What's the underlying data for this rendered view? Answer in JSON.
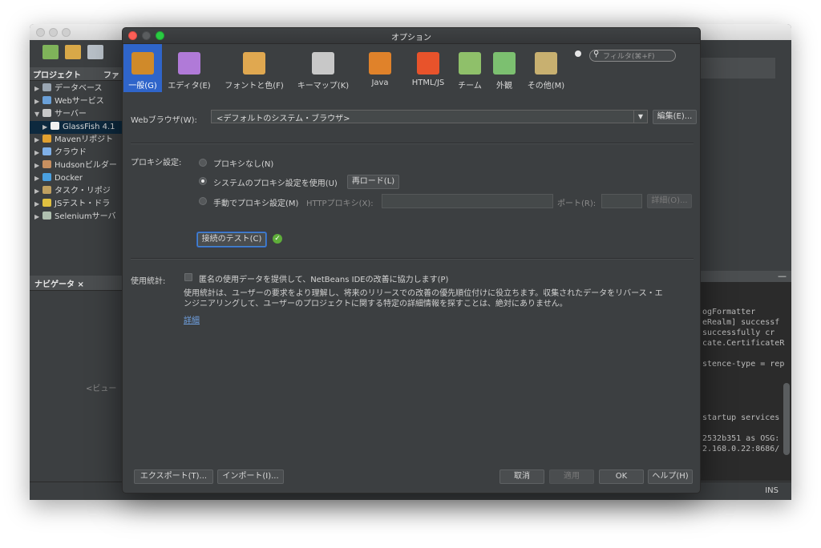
{
  "ide": {
    "project_tab": "プロジェクト",
    "files_tab": "ファ",
    "tree": [
      {
        "label": "データベース",
        "color": "#9aa6b2"
      },
      {
        "label": "Webサービス",
        "color": "#6aa0d8"
      },
      {
        "label": "サーバー",
        "color": "#c8c8c8"
      },
      {
        "label": "GlassFish 4.1",
        "color": "#f0f0f0",
        "selected": true
      },
      {
        "label": "Mavenリポジト",
        "color": "#e0a030"
      },
      {
        "label": "クラウド",
        "color": "#7fb0e8"
      },
      {
        "label": "Hudsonビルダー",
        "color": "#c89060"
      },
      {
        "label": "Docker",
        "color": "#4aa0e0"
      },
      {
        "label": "タスク・リポジ",
        "color": "#c0a060"
      },
      {
        "label": "JSテスト・ドラ",
        "color": "#e0c040"
      },
      {
        "label": "Seleniumサーバ",
        "color": "#b0c0b0"
      }
    ],
    "navigator_tab": "ナビゲータ ×",
    "navigator_empty": "<ビュー",
    "output_lines": [
      "ogFormatter",
      "eRealm] successf",
      " successfully cr",
      "cate.CertificateR",
      "stence-type = rep",
      " startup services",
      "2532b351 as OSG:",
      "2.168.0.22:8686/"
    ],
    "status_ins": "INS"
  },
  "dialog": {
    "title": "オプション",
    "categories": [
      {
        "label": "一般(G)",
        "icon": "general-icon",
        "color": "#d08a2a"
      },
      {
        "label": "エディタ(E)",
        "icon": "editor-icon",
        "color": "#b07ad8"
      },
      {
        "label": "フォントと色(F)",
        "icon": "fonts-icon",
        "color": "#e0a850"
      },
      {
        "label": "キーマップ(K)",
        "icon": "keymap-icon",
        "color": "#c8c8c8"
      },
      {
        "label": "Java",
        "icon": "java-icon",
        "color": "#e0822a"
      },
      {
        "label": "HTML/JS",
        "icon": "html5-icon",
        "color": "#e8532b"
      },
      {
        "label": "チーム",
        "icon": "team-icon",
        "color": "#8fc06a"
      },
      {
        "label": "外観",
        "icon": "appearance-icon",
        "color": "#7cc070"
      },
      {
        "label": "その他(M)",
        "icon": "misc-icon",
        "color": "#c8b070"
      }
    ],
    "search_placeholder": "フィルタ(⌘+F)",
    "web_browser_label": "Webブラウザ(W):",
    "web_browser_value": "<デフォルトのシステム・ブラウザ>",
    "edit_button": "編集(E)...",
    "proxy_label": "プロキシ設定:",
    "proxy_none": "プロキシなし(N)",
    "proxy_system": "システムのプロキシ設定を使用(U)",
    "reload_button": "再ロード(L)",
    "proxy_manual": "手動でプロキシ設定(M)",
    "http_proxy_label": "HTTPプロキシ(X):",
    "port_label": "ポート(R):",
    "details_button": "詳細(O)...",
    "test_connection_button": "接続のテスト(C)",
    "usage_label": "使用統計:",
    "usage_checkbox": "匿名の使用データを提供して、NetBeans IDEの改善に協力します(P)",
    "usage_text_1": "使用統計は、ユーザーの要求をより理解し、将来のリリースでの改善の優先順位付けに役立ちます。収集されたデータをリバース・エ",
    "usage_text_2": "ンジニアリングして、ユーザーのプロジェクトに関する特定の詳細情報を探すことは、絶対にありません。",
    "details_link": "詳細",
    "export_button": "エクスポート(T)...",
    "import_button": "インポート(I)...",
    "cancel_button": "取消",
    "apply_button": "適用",
    "ok_button": "OK",
    "help_button": "ヘルプ(H)"
  }
}
